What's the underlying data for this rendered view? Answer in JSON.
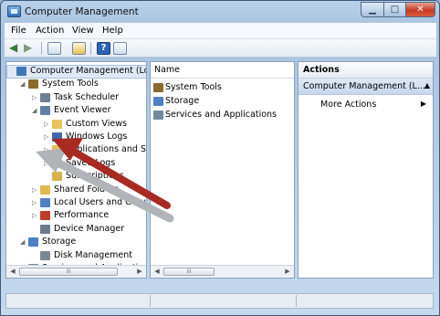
{
  "window": {
    "title": "Computer Management",
    "min": "▁",
    "max": "□",
    "close": "✕"
  },
  "menu": [
    "File",
    "Action",
    "View",
    "Help"
  ],
  "toolbar": {
    "help": "?"
  },
  "tree": [
    {
      "label": "Computer Management (Local",
      "indent": 0,
      "exp": "",
      "icon": "#3f77b6",
      "selected": true
    },
    {
      "label": "System Tools",
      "indent": 1,
      "exp": "◢",
      "icon": "#8a6a2c"
    },
    {
      "label": "Task Scheduler",
      "indent": 2,
      "exp": "▷",
      "icon": "#6d7f90"
    },
    {
      "label": "Event Viewer",
      "indent": 2,
      "exp": "◢",
      "icon": "#5f7fa3"
    },
    {
      "label": "Custom Views",
      "indent": 3,
      "exp": "▷",
      "icon": "#e8c25a"
    },
    {
      "label": "Windows Logs",
      "indent": 3,
      "exp": "▷",
      "icon": "#3d69b0"
    },
    {
      "label": "Applications and Se",
      "indent": 3,
      "exp": "▷",
      "icon": "#e8c25a"
    },
    {
      "label": "Saved Logs",
      "indent": 3,
      "exp": "▷",
      "icon": "#e8c25a"
    },
    {
      "label": "Subscriptions",
      "indent": 3,
      "exp": "",
      "icon": "#d8b24e"
    },
    {
      "label": "Shared Folders",
      "indent": 2,
      "exp": "▷",
      "icon": "#e0b84f"
    },
    {
      "label": "Local Users and Groups",
      "indent": 2,
      "exp": "▷",
      "icon": "#4f7fc4"
    },
    {
      "label": "Performance",
      "indent": 2,
      "exp": "▷",
      "icon": "#c23b2a"
    },
    {
      "label": "Device Manager",
      "indent": 2,
      "exp": "",
      "icon": "#6b7b8c"
    },
    {
      "label": "Storage",
      "indent": 1,
      "exp": "◢",
      "icon": "#4f7fc4"
    },
    {
      "label": "Disk Management",
      "indent": 2,
      "exp": "",
      "icon": "#7a8797"
    },
    {
      "label": "Services and Applications",
      "indent": 1,
      "exp": "▷",
      "icon": "#6f8a9f"
    }
  ],
  "middle": {
    "column": "Name",
    "items": [
      {
        "label": "System Tools",
        "icon": "#8a6a2c"
      },
      {
        "label": "Storage",
        "icon": "#4f7fc4"
      },
      {
        "label": "Services and Applications",
        "icon": "#6f8a9f"
      }
    ]
  },
  "actions": {
    "header": "Actions",
    "group": "Computer Management (L...",
    "group_caret": "▲",
    "item": "More Actions",
    "item_caret": "▶"
  },
  "scroll": {
    "left": "◀",
    "right": "▶",
    "thumb": "III"
  }
}
